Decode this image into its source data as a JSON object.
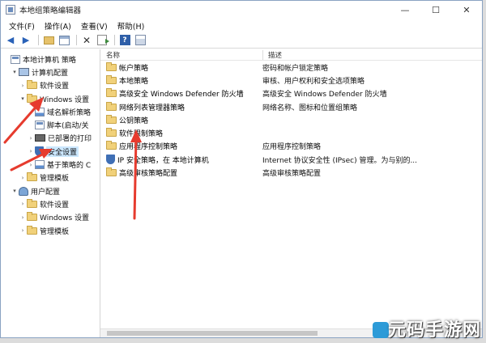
{
  "window": {
    "title": "本地组策略编辑器"
  },
  "menu": [
    "文件(F)",
    "操作(A)",
    "查看(V)",
    "帮助(H)"
  ],
  "tree": [
    {
      "label": "本地计算机 策略",
      "icon": "doc-icon",
      "indent": 0,
      "twisty": ""
    },
    {
      "label": "计算机配置",
      "icon": "computer-icon",
      "indent": 1,
      "twisty": "▾"
    },
    {
      "label": "软件设置",
      "icon": "folder-icon",
      "indent": 2,
      "twisty": "›"
    },
    {
      "label": "Windows 设置",
      "icon": "folder-icon",
      "indent": 2,
      "twisty": "▾"
    },
    {
      "label": "域名解析策略",
      "icon": "chart-icon",
      "indent": 3,
      "twisty": ""
    },
    {
      "label": "脚本(启动/关",
      "icon": "doc-icon",
      "indent": 3,
      "twisty": ""
    },
    {
      "label": "已部署的打印",
      "icon": "printer-icon",
      "indent": 3,
      "twisty": "›"
    },
    {
      "label": "安全设置",
      "icon": "shield-icon",
      "indent": 3,
      "twisty": "›",
      "selected": true
    },
    {
      "label": "基于策略的 C",
      "icon": "chart-icon",
      "indent": 3,
      "twisty": "›"
    },
    {
      "label": "管理模板",
      "icon": "folder-icon",
      "indent": 2,
      "twisty": "›"
    },
    {
      "label": "用户配置",
      "icon": "user-icon",
      "indent": 1,
      "twisty": "▾"
    },
    {
      "label": "软件设置",
      "icon": "folder-icon",
      "indent": 2,
      "twisty": "›"
    },
    {
      "label": "Windows 设置",
      "icon": "folder-icon",
      "indent": 2,
      "twisty": "›"
    },
    {
      "label": "管理模板",
      "icon": "folder-icon",
      "indent": 2,
      "twisty": "›"
    }
  ],
  "list": {
    "columns": {
      "name": "名称",
      "desc": "描述"
    },
    "rows": [
      {
        "name": "帐户策略",
        "desc": "密码和帐户锁定策略",
        "icon": "folder-icon"
      },
      {
        "name": "本地策略",
        "desc": "审核、用户权利和安全选项策略",
        "icon": "folder-icon"
      },
      {
        "name": "高级安全 Windows Defender 防火墙",
        "desc": "高级安全 Windows Defender 防火墙",
        "icon": "folder-icon"
      },
      {
        "name": "网络列表管理器策略",
        "desc": "网络名称、图标和位置组策略",
        "icon": "folder-icon"
      },
      {
        "name": "公钥策略",
        "desc": "",
        "icon": "folder-icon"
      },
      {
        "name": "软件限制策略",
        "desc": "",
        "icon": "folder-icon"
      },
      {
        "name": "应用程序控制策略",
        "desc": "应用程序控制策略",
        "icon": "folder-icon"
      },
      {
        "name": "IP 安全策略，在 本地计算机",
        "desc": "Internet 协议安全性 (IPsec) 管理。为与别的...",
        "icon": "shield-icon"
      },
      {
        "name": "高级审核策略配置",
        "desc": "高级审核策略配置",
        "icon": "folder-icon"
      }
    ]
  },
  "watermark": "元码手游网",
  "colors": {
    "selection": "#cce8ff",
    "folder": "#f1d17a",
    "annotation_arrow": "#e63b2e"
  }
}
